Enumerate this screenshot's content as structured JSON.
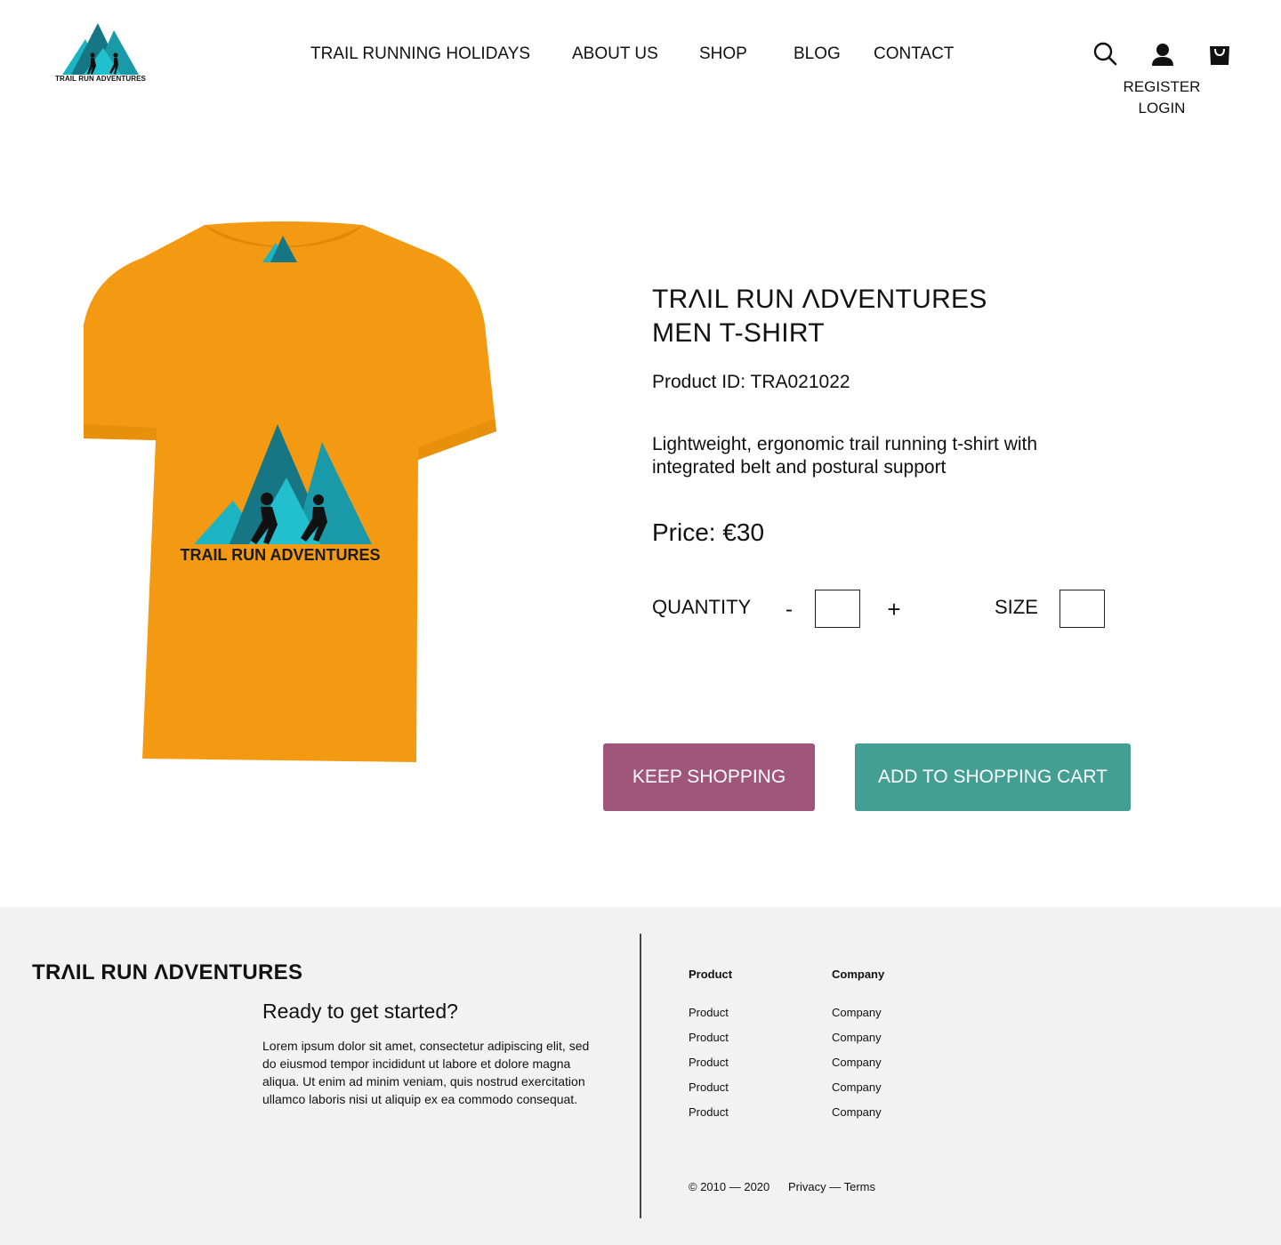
{
  "header": {
    "logo_text": "TRAIL RUN ADVENTURES",
    "nav": [
      {
        "label": "TRAIL RUNNING HOLIDAYS"
      },
      {
        "label": "ABOUT US"
      },
      {
        "label": "SHOP"
      },
      {
        "label": "BLOG"
      },
      {
        "label": "CONTACT"
      }
    ],
    "icons": [
      "search-icon",
      "user-icon",
      "shopping-bag-icon"
    ],
    "register_label": "REGISTER",
    "login_label": "LOGIN"
  },
  "product": {
    "image": "orange-tshirt-with-mountain-logo",
    "shirt_print_text": "TRAIL RUN ADVENTURES",
    "title_line1": "TRΛIL RUN ΛDVENTURES",
    "title_line2": "MEN T-SHIRT",
    "id_text": "Product ID: TRA021022",
    "description": "Lightweight, ergonomic trail running t-shirt with integrated belt and postural support",
    "price_text": "Price: €30",
    "quantity_label": "QUANTITY",
    "minus_label": "-",
    "plus_label": "+",
    "quantity_value": "",
    "size_label": "SIZE",
    "size_value": "",
    "keep_shopping_label": "KEEP SHOPPING",
    "add_to_cart_label": "ADD TO SHOPPING CART"
  },
  "colors": {
    "shirt": "#f39a12",
    "teal_dark": "#177683",
    "teal_light": "#1cb3c3",
    "keep_button": "#a0557a",
    "add_button": "#439e93",
    "footer_bg": "#f2f2f2"
  },
  "footer": {
    "brand": "TRΛIL RUN ΛDVENTURES",
    "heading": "Ready to get started?",
    "body": "Lorem ipsum dolor sit amet, consectetur adipiscing elit, sed do eiusmod tempor incididunt ut labore et dolore magna aliqua. Ut enim ad minim veniam, quis nostrud exercitation ullamco laboris nisi ut aliquip ex ea commodo consequat.",
    "product_col": {
      "title": "Product",
      "links": [
        "Product",
        "Product",
        "Product",
        "Product",
        "Product"
      ]
    },
    "company_col": {
      "title": "Company",
      "links": [
        "Company",
        "Company",
        "Company",
        "Company",
        "Company"
      ]
    },
    "copyright": "© 2010 — 2020",
    "legal": "Privacy — Terms"
  }
}
